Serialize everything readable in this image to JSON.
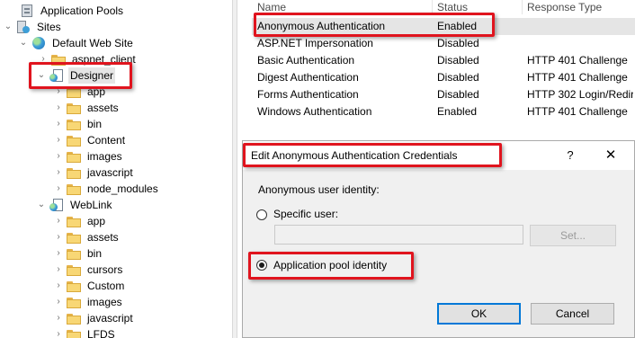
{
  "tree": {
    "items": [
      {
        "label": "Application Pools",
        "icon": "app-pool-icon",
        "chevron": ""
      },
      {
        "label": "Sites",
        "icon": "sites-icon",
        "chevron": "expanded"
      },
      {
        "label": "Default Web Site",
        "icon": "globe-icon",
        "chevron": "expanded"
      },
      {
        "label": "aspnet_client",
        "icon": "folder-icon",
        "chevron": "collapsed"
      },
      {
        "label": "Designer",
        "icon": "web-app-icon",
        "chevron": "expanded",
        "selected": true
      },
      {
        "label": "app",
        "icon": "folder-icon",
        "chevron": "collapsed"
      },
      {
        "label": "assets",
        "icon": "folder-icon",
        "chevron": "collapsed"
      },
      {
        "label": "bin",
        "icon": "folder-icon",
        "chevron": "collapsed"
      },
      {
        "label": "Content",
        "icon": "folder-icon",
        "chevron": "collapsed"
      },
      {
        "label": "images",
        "icon": "folder-icon",
        "chevron": "collapsed"
      },
      {
        "label": "javascript",
        "icon": "folder-icon",
        "chevron": "collapsed"
      },
      {
        "label": "node_modules",
        "icon": "folder-icon",
        "chevron": "collapsed"
      },
      {
        "label": "WebLink",
        "icon": "web-app-icon",
        "chevron": "expanded"
      },
      {
        "label": "app",
        "icon": "folder-icon",
        "chevron": "collapsed"
      },
      {
        "label": "assets",
        "icon": "folder-icon",
        "chevron": "collapsed"
      },
      {
        "label": "bin",
        "icon": "folder-icon",
        "chevron": "collapsed"
      },
      {
        "label": "cursors",
        "icon": "folder-icon",
        "chevron": "collapsed"
      },
      {
        "label": "Custom",
        "icon": "folder-icon",
        "chevron": "collapsed"
      },
      {
        "label": "images",
        "icon": "folder-icon",
        "chevron": "collapsed"
      },
      {
        "label": "javascript",
        "icon": "folder-icon",
        "chevron": "collapsed"
      },
      {
        "label": "LFDS",
        "icon": "folder-icon",
        "chevron": "collapsed"
      }
    ]
  },
  "auth": {
    "columns": {
      "name": "Name",
      "status": "Status",
      "response": "Response Type"
    },
    "rows": [
      {
        "name": "Anonymous Authentication",
        "status": "Enabled",
        "response": "",
        "selected": true
      },
      {
        "name": "ASP.NET Impersonation",
        "status": "Disabled",
        "response": ""
      },
      {
        "name": "Basic Authentication",
        "status": "Disabled",
        "response": "HTTP 401 Challenge"
      },
      {
        "name": "Digest Authentication",
        "status": "Disabled",
        "response": "HTTP 401 Challenge"
      },
      {
        "name": "Forms Authentication",
        "status": "Disabled",
        "response": "HTTP 302 Login/Redire"
      },
      {
        "name": "Windows Authentication",
        "status": "Enabled",
        "response": "HTTP 401 Challenge"
      }
    ]
  },
  "dialog": {
    "title": "Edit Anonymous Authentication Credentials",
    "help_glyph": "?",
    "close_glyph": "✕",
    "group_label": "Anonymous user identity:",
    "specific_user_label": "Specific user:",
    "specific_user_value": "",
    "specific_user_selected": false,
    "set_button": "Set...",
    "app_pool_label": "Application pool identity",
    "app_pool_selected": true,
    "ok_button": "OK",
    "cancel_button": "Cancel"
  },
  "highlight_color": "#e0141e"
}
